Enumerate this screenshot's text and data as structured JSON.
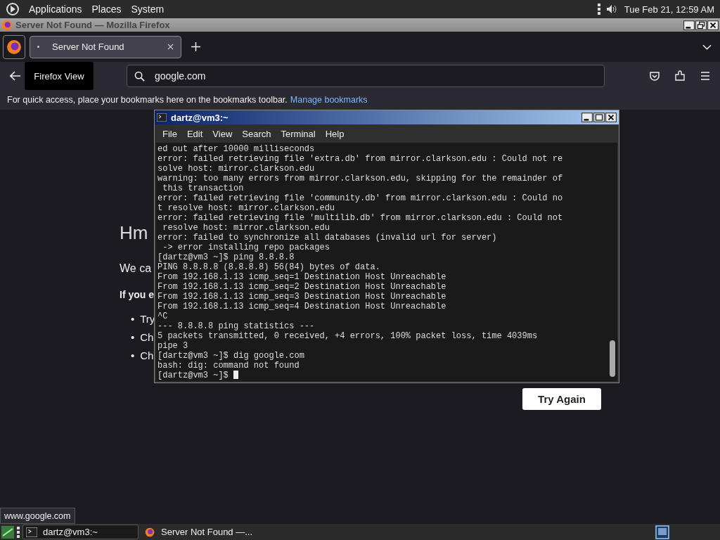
{
  "top_panel": {
    "menus": [
      "Applications",
      "Places",
      "System"
    ],
    "clock": "Tue Feb 21, 12:59 AM"
  },
  "window": {
    "title": "Server Not Found — Mozilla Firefox"
  },
  "tabs": [
    {
      "label": "Server Not Found",
      "selected": true
    }
  ],
  "tooltip": "Firefox View",
  "url": "google.com",
  "bookmarks_bar": {
    "text": "For quick access, place your bookmarks here on the bookmarks toolbar.",
    "link": "Manage bookmarks"
  },
  "page": {
    "marker": "•",
    "heading": "Hm",
    "text": "We ca",
    "bold_text": "If you e",
    "bullets": [
      "Try",
      "Ch",
      "Ch"
    ],
    "button": "Try Again"
  },
  "terminal": {
    "title": "dartz@vm3:~",
    "menus": [
      "File",
      "Edit",
      "View",
      "Search",
      "Terminal",
      "Help"
    ],
    "lines": [
      "ed out after 10000 milliseconds",
      "error: failed retrieving file 'extra.db' from mirror.clarkson.edu : Could not re",
      "solve host: mirror.clarkson.edu",
      "warning: too many errors from mirror.clarkson.edu, skipping for the remainder of",
      " this transaction",
      "error: failed retrieving file 'community.db' from mirror.clarkson.edu : Could no",
      "t resolve host: mirror.clarkson.edu",
      "error: failed retrieving file 'multilib.db' from mirror.clarkson.edu : Could not",
      " resolve host: mirror.clarkson.edu",
      "error: failed to synchronize all databases (invalid url for server)",
      " -> error installing repo packages",
      "[dartz@vm3 ~]$ ping 8.8.8.8",
      "PING 8.8.8.8 (8.8.8.8) 56(84) bytes of data.",
      "From 192.168.1.13 icmp_seq=1 Destination Host Unreachable",
      "From 192.168.1.13 icmp_seq=2 Destination Host Unreachable",
      "From 192.168.1.13 icmp_seq=3 Destination Host Unreachable",
      "From 192.168.1.13 icmp_seq=4 Destination Host Unreachable",
      "^C",
      "--- 8.8.8.8 ping statistics ---",
      "5 packets transmitted, 0 received, +4 errors, 100% packet loss, time 4039ms",
      "pipe 3",
      "[dartz@vm3 ~]$ dig google.com",
      "bash: dig: command not found",
      "[dartz@vm3 ~]$ "
    ]
  },
  "status_link": "www.google.com",
  "taskbar": [
    {
      "label": "dartz@vm3:~",
      "kind": "terminal",
      "selected": true
    },
    {
      "label": "Server Not Found —...",
      "kind": "browser",
      "selected": false
    }
  ]
}
